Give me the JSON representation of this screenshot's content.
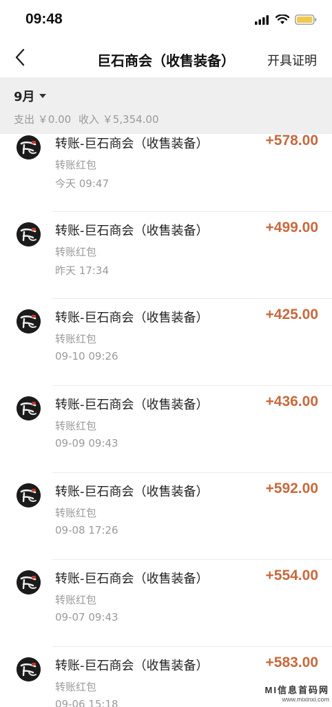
{
  "status_bar": {
    "time": "09:48"
  },
  "nav": {
    "title": "巨石商会（收售装备）",
    "action": "开具证明"
  },
  "summary": {
    "month": "9月",
    "expense": "支出 ￥0.00",
    "income": "收入 ￥5,354.00"
  },
  "transactions": [
    {
      "title": "转账-巨石商会（收售装备）",
      "type": "转账红包",
      "time": "今天  09:47",
      "amount": "+578.00"
    },
    {
      "title": "转账-巨石商会（收售装备）",
      "type": "转账红包",
      "time": "昨天  17:34",
      "amount": "+499.00"
    },
    {
      "title": "转账-巨石商会（收售装备）",
      "type": "转账红包",
      "time": "09-10  09:26",
      "amount": "+425.00"
    },
    {
      "title": "转账-巨石商会（收售装备）",
      "type": "转账红包",
      "time": "09-09  09:43",
      "amount": "+436.00"
    },
    {
      "title": "转账-巨石商会（收售装备）",
      "type": "转账红包",
      "time": "09-08  17:26",
      "amount": "+592.00"
    },
    {
      "title": "转账-巨石商会（收售装备）",
      "type": "转账红包",
      "time": "09-07  09:43",
      "amount": "+554.00"
    },
    {
      "title": "转账-巨石商会（收售装备）",
      "type": "转账红包",
      "time": "09-06  15:18",
      "amount": "+583.00"
    }
  ],
  "watermark": {
    "line1": "MI信息首码网",
    "line2": "www.mixinxi.com"
  },
  "colors": {
    "amount": "#c8693d",
    "summary_bg": "#efefef",
    "battery": "#f2c94c"
  },
  "icons": {
    "back": "chevron-left-icon",
    "caret": "caret-down-icon",
    "signal": "signal-icon",
    "wifi": "wifi-icon",
    "battery": "battery-icon"
  }
}
